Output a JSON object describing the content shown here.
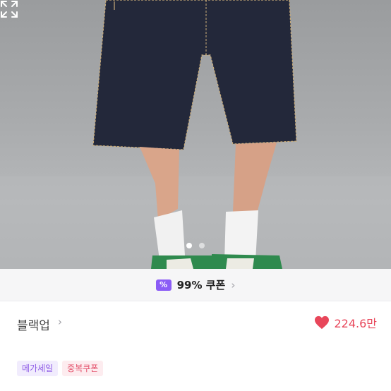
{
  "gallery": {
    "image_alt": "",
    "dot_count": 2,
    "active_dot_index": 0
  },
  "coupon": {
    "badge": "%",
    "text": "99% 쿠폰",
    "accent": "#8b5cf6"
  },
  "store": {
    "name": "블랙업"
  },
  "like": {
    "count": "224.6만",
    "color": "#e8465a"
  },
  "tags": [
    {
      "label": "메가세일",
      "color": "#8f5ce6"
    },
    {
      "label": "중복쿠폰",
      "color": "#e3506a"
    }
  ],
  "description": {
    "text": ""
  },
  "icons": {
    "expand": "expand-icon",
    "coupon": "coupon-ticket-icon",
    "store_chevron": "chevron-right-icon",
    "like": "heart-icon"
  }
}
